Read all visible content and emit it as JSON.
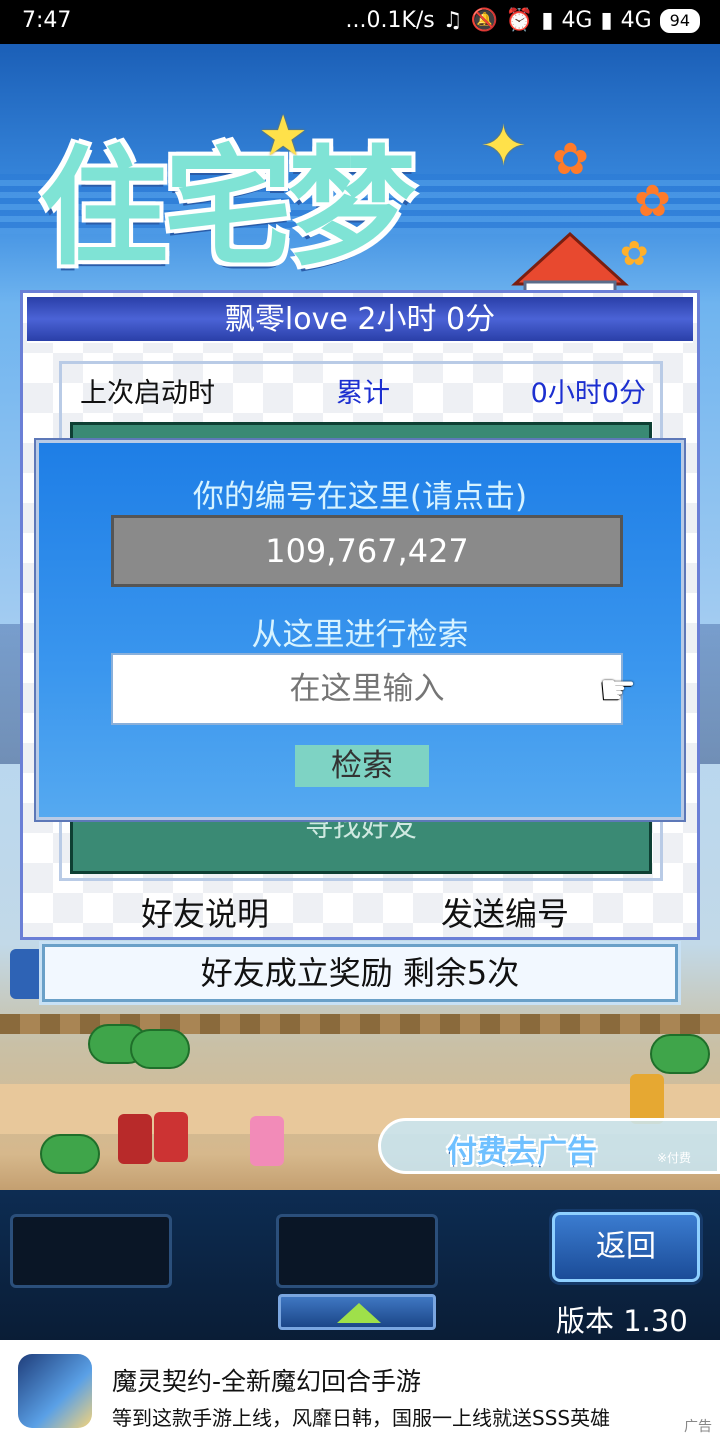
{
  "status_bar": {
    "time": "7:47",
    "network": "...0.1K/s",
    "signal1": "4G",
    "signal2": "4G",
    "battery": "94"
  },
  "game": {
    "logo_text": "住宅梦",
    "panel": {
      "title": "飘零love  2小时 0分",
      "last_launch_label": "上次启动时",
      "total_label": "累计",
      "total_value": "0小时0分",
      "find_friend": "寻找好友",
      "friend_help": "好友说明",
      "send_id": "发送编号"
    },
    "dialog": {
      "id_title": "你的编号在这里(请点击)",
      "id_value": "109,767,427",
      "search_title": "从这里进行检索",
      "search_placeholder": "在这里输入",
      "search_button": "检索"
    },
    "reward_banner": "好友成立奖励  剩余5次",
    "remove_ads": {
      "label": "付费去广告",
      "note": "※付费"
    },
    "bottom": {
      "back_button": "返回",
      "version": "版本 1.30"
    }
  },
  "ad": {
    "title": "魔灵契约-全新魔幻回合手游",
    "description": "等到这款手游上线，风靡日韩，国服一上线就送SSS英雄",
    "tag": "广告"
  },
  "colors": {
    "panel_title": "#2a3fa8",
    "dialog_blue": "#1e7ee6",
    "green_box": "#3a8a74",
    "accent_text": "#1c2fd0"
  }
}
